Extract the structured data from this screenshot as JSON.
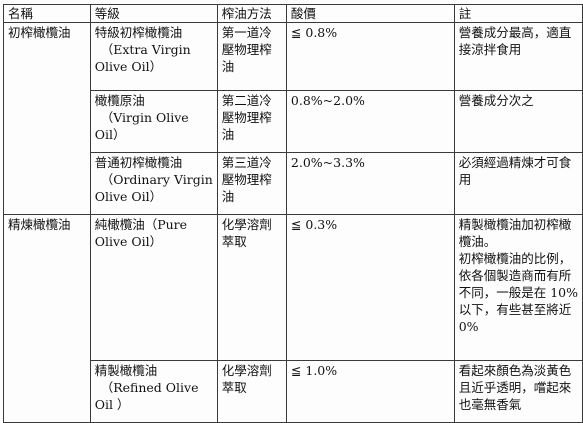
{
  "table": {
    "headers": [
      "名稱",
      "等級",
      "榨油方法",
      "酸價",
      "註"
    ],
    "groups": [
      {
        "name": "初榨橄欖油",
        "rows": [
          {
            "grade": [
              "特級初榨橄欖油",
              "（Extra Virgin",
              "Olive Oil）"
            ],
            "method": [
              "第一道冷",
              "壓物理榨",
              "油"
            ],
            "acidity": "≦ 0.8%",
            "note": [
              "營養成分最高，適直",
              "接涼拌食用"
            ]
          },
          {
            "grade": [
              "橄欖原油",
              "（Virgin Olive",
              "Oil）"
            ],
            "method": [
              "第二道冷",
              "壓物理榨",
              "油"
            ],
            "acidity": "0.8%~2.0%",
            "note": [
              "營養成分次之"
            ]
          },
          {
            "grade": [
              "普通初榨橄欖油",
              "（Ordinary Virgin",
              "Olive Oil）"
            ],
            "method": [
              "第三道冷",
              "壓物理榨",
              "油"
            ],
            "acidity": "2.0%~3.3%",
            "note": [
              "必須經過精煉才可食",
              "用"
            ]
          }
        ]
      },
      {
        "name": "精煉橄欖油",
        "rows": [
          {
            "grade": [
              "純橄欖油（Pure",
              "Olive Oil）"
            ],
            "method": [
              "化學溶劑",
              "萃取"
            ],
            "acidity": "≦ 0.3%",
            "note": [
              "精製橄欖油加初榨橄",
              "欖油。",
              "初榨橄欖油的比例，",
              "依各個製造商而有所",
              "不同，一般是在 10%",
              "以下，有些甚至將近",
              "0%"
            ]
          },
          {
            "grade": [
              "精製橄欖油",
              "（Refined Olive",
              "Oil ）"
            ],
            "method": [
              "化學溶劑",
              "萃取"
            ],
            "acidity": "≦ 1.0%",
            "note": [
              "看起來顏色為淡黃色",
              "且近乎透明，嚐起來",
              "也毫無香氣"
            ]
          }
        ]
      }
    ]
  }
}
